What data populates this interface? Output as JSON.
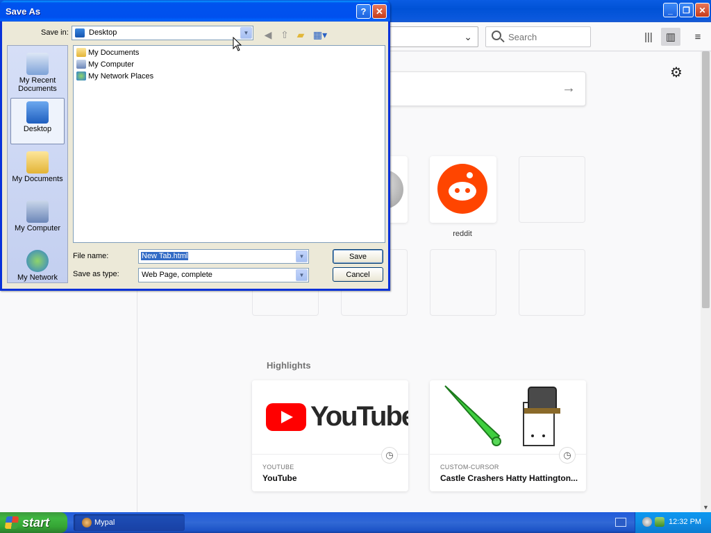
{
  "browser": {
    "search_placeholder": "Search",
    "tiles": [
      {
        "label": "reddit"
      }
    ],
    "highlights": {
      "title": "Highlights",
      "cards": [
        {
          "source": "YOUTUBE",
          "title": "YouTube",
          "logo_text": "YouTube"
        },
        {
          "source": "CUSTOM-CURSOR",
          "title": "Castle Crashers Hatty Hattington..."
        }
      ]
    },
    "icons": [
      "library-icon",
      "sidebar-icon",
      "menu-icon",
      "gear-icon",
      "arrow-right-icon"
    ]
  },
  "dialog": {
    "title": "Save As",
    "save_in_label": "Save in:",
    "save_in_value": "Desktop",
    "places": [
      {
        "label": "My Recent Documents"
      },
      {
        "label": "Desktop"
      },
      {
        "label": "My Documents"
      },
      {
        "label": "My Computer"
      },
      {
        "label": "My Network"
      }
    ],
    "files": [
      {
        "name": "My Documents"
      },
      {
        "name": "My Computer"
      },
      {
        "name": "My Network Places"
      }
    ],
    "file_name_label": "File name:",
    "file_name_value": "New Tab.html",
    "save_type_label": "Save as type:",
    "save_type_value": "Web Page, complete",
    "save_button": "Save",
    "cancel_button": "Cancel"
  },
  "taskbar": {
    "start_label": "start",
    "task_label": "Mypal",
    "clock": "12:32 PM"
  },
  "colors": {
    "xp_title_blue": "#0053ee",
    "reddit_orange": "#ff4500",
    "youtube_red": "#ff0000",
    "start_green": "#3fb740"
  }
}
